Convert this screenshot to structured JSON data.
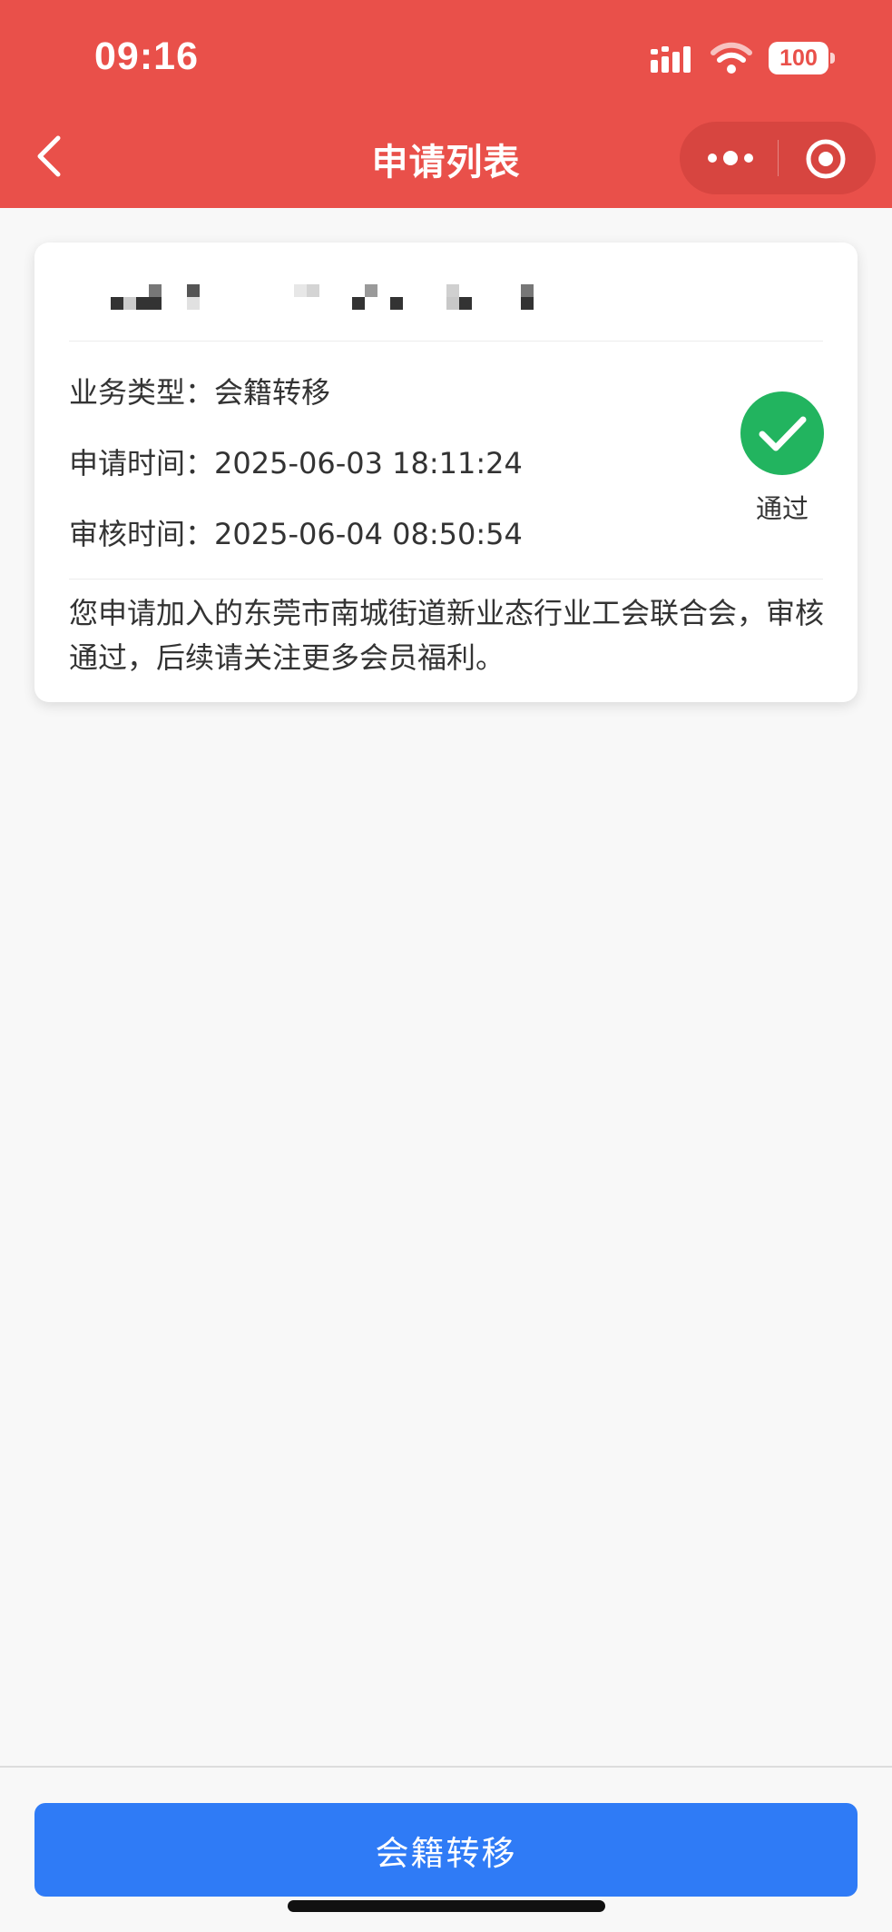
{
  "status_bar": {
    "time": "09:16",
    "battery": "100"
  },
  "header": {
    "title": "申请列表",
    "back_icon": "chevron-left-icon",
    "more_icon": "more-dots-icon",
    "close_icon": "target-icon"
  },
  "application_card": {
    "org_name_redacted": true,
    "business_type_label": "业务类型：",
    "business_type_value": "会籍转移",
    "apply_time_label": "申请时间：",
    "apply_time_value": "2025-06-03 18:11:24",
    "review_time_label": "审核时间：",
    "review_time_value": "2025-06-04 08:50:54",
    "status_icon": "check-circle-icon",
    "status": "通过",
    "message": "您申请加入的东莞市南城街道新业态行业工会联合会，审核通过，后续请关注更多会员福利。"
  },
  "footer": {
    "button_label": "会籍转移"
  },
  "colors": {
    "header_bg": "#e9504a",
    "status_green": "#22b45f",
    "button_blue": "#2f7bf6",
    "page_bg": "#f8f8f8"
  }
}
